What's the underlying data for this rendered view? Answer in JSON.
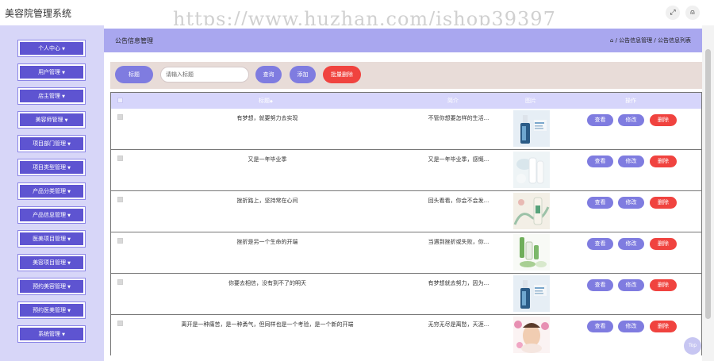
{
  "app": {
    "title": "美容院管理系统",
    "watermark": "https://www.huzhan.com/ishop39397"
  },
  "top_icons": [
    "expand-icon",
    "user-icon"
  ],
  "sidebar": {
    "items": [
      {
        "label": "个人中心"
      },
      {
        "label": "用户管理"
      },
      {
        "label": "店主管理"
      },
      {
        "label": "美容师管理"
      },
      {
        "label": "项目部门管理"
      },
      {
        "label": "项目类型管理"
      },
      {
        "label": "产品分类管理"
      },
      {
        "label": "产品信息管理"
      },
      {
        "label": "医美项目管理"
      },
      {
        "label": "美容项目管理"
      },
      {
        "label": "预约美容管理"
      },
      {
        "label": "预约医美管理"
      },
      {
        "label": "系统管理"
      }
    ]
  },
  "breadcrumb": {
    "title": "公告信息管理",
    "path": "/ 公告信息管理 / 公告信息列表"
  },
  "search": {
    "label": "标题",
    "placeholder": "请输入标题",
    "query_label": "查询",
    "add_label": "添加",
    "batch_delete_label": "批量删除"
  },
  "table": {
    "headers": {
      "title": "标题",
      "intro": "简介",
      "image": "图片",
      "actions": "操作"
    },
    "actions": {
      "view": "查看",
      "edit": "修改",
      "delete": "删除"
    },
    "rows": [
      {
        "title": "有梦想，就要努力去实现",
        "intro": "不管你想要怎样的生活...",
        "image": "serum-bottle"
      },
      {
        "title": "又是一年毕业季",
        "intro": "又是一年毕业季，感慨...",
        "image": "cream-tube"
      },
      {
        "title": "挫折路上，坚持常在心间",
        "intro": "回头看看，你会不会发...",
        "image": "green-tube"
      },
      {
        "title": "挫折是另一个生命的开端",
        "intro": "当遇到挫折或失败，你...",
        "image": "skincare-set"
      },
      {
        "title": "你要去相信，没有到不了的明天",
        "intro": "有梦想就去努力，因为...",
        "image": "serum-bottle"
      },
      {
        "title": "离开是一种痛苦，是一种勇气，但同样也是一个考验，是一个新的开端",
        "intro": "无穷无尽是离愁，天涯...",
        "image": "facial-woman"
      }
    ]
  },
  "back_to_top": "Top",
  "colors": {
    "primary": "#7f7ce0",
    "sidebar_button": "#5e54d1",
    "danger": "#f0433f",
    "sidebar_bg": "#d7d6f8",
    "header_bg": "#a9a7ef"
  }
}
